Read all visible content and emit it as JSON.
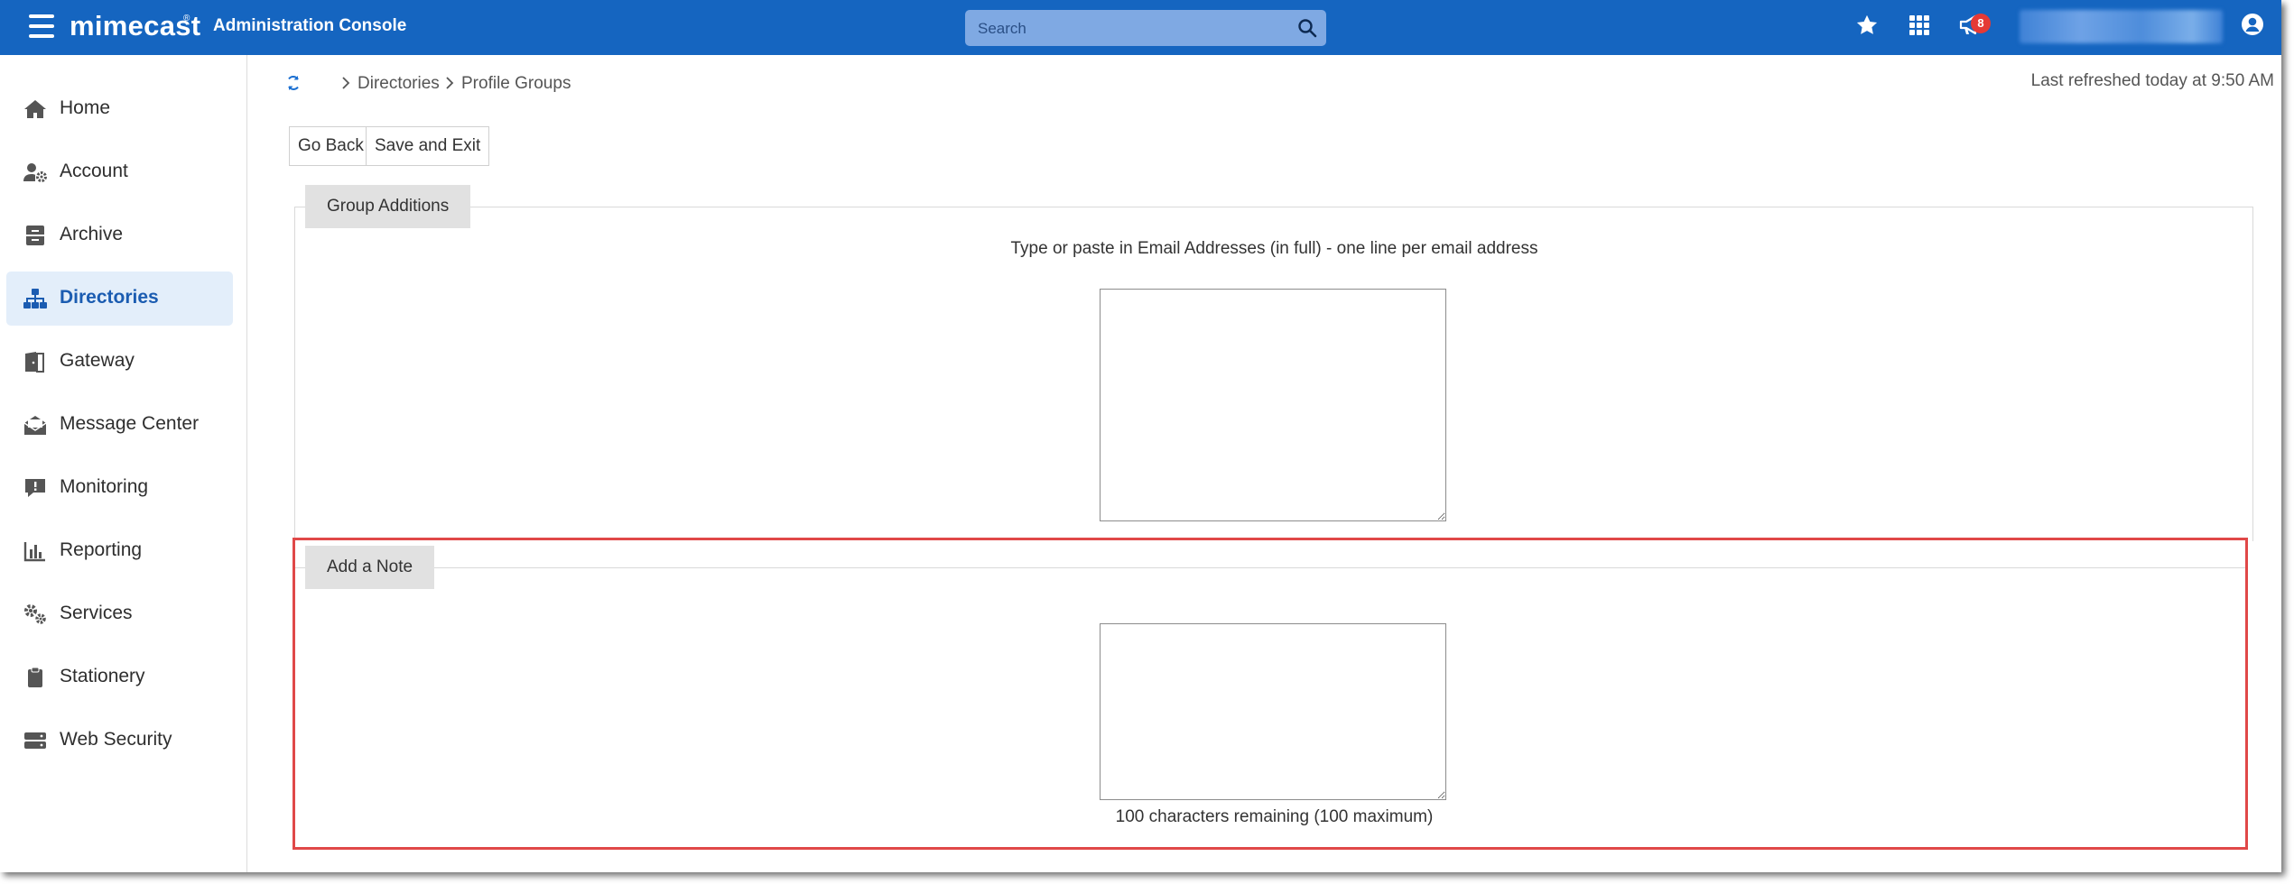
{
  "header": {
    "brand": "mimecast",
    "brand_mark": "®",
    "console_title": "Administration Console",
    "search_placeholder": "Search",
    "notification_count": "8"
  },
  "sidebar": {
    "items": [
      {
        "label": "Home",
        "icon": "home-icon"
      },
      {
        "label": "Account",
        "icon": "account-gear-icon"
      },
      {
        "label": "Archive",
        "icon": "archive-icon"
      },
      {
        "label": "Directories",
        "icon": "directory-tree-icon",
        "active": true
      },
      {
        "label": "Gateway",
        "icon": "gateway-door-icon"
      },
      {
        "label": "Message Center",
        "icon": "envelope-open-icon"
      },
      {
        "label": "Monitoring",
        "icon": "monitoring-alert-icon"
      },
      {
        "label": "Reporting",
        "icon": "bar-chart-icon"
      },
      {
        "label": "Services",
        "icon": "gears-icon"
      },
      {
        "label": "Stationery",
        "icon": "clipboard-icon"
      },
      {
        "label": "Web Security",
        "icon": "server-icon"
      }
    ]
  },
  "breadcrumb": {
    "items": [
      "Directories",
      "Profile Groups"
    ]
  },
  "status": {
    "last_refreshed": "Last refreshed today at 9:50 AM"
  },
  "toolbar": {
    "go_back": "Go Back",
    "save_exit": "Save and Exit"
  },
  "group_additions": {
    "title": "Group Additions",
    "instructions": "Type or paste in Email Addresses (in full) - one line per email address",
    "value": ""
  },
  "note": {
    "title": "Add a Note",
    "value": "",
    "counter": "100 characters remaining (100 maximum)"
  },
  "colors": {
    "header_bg": "#1565c0",
    "active_nav_bg": "#e3eefa",
    "active_nav_text": "#1b5cb1",
    "highlight_border": "#e04848",
    "badge": "#e53935"
  }
}
